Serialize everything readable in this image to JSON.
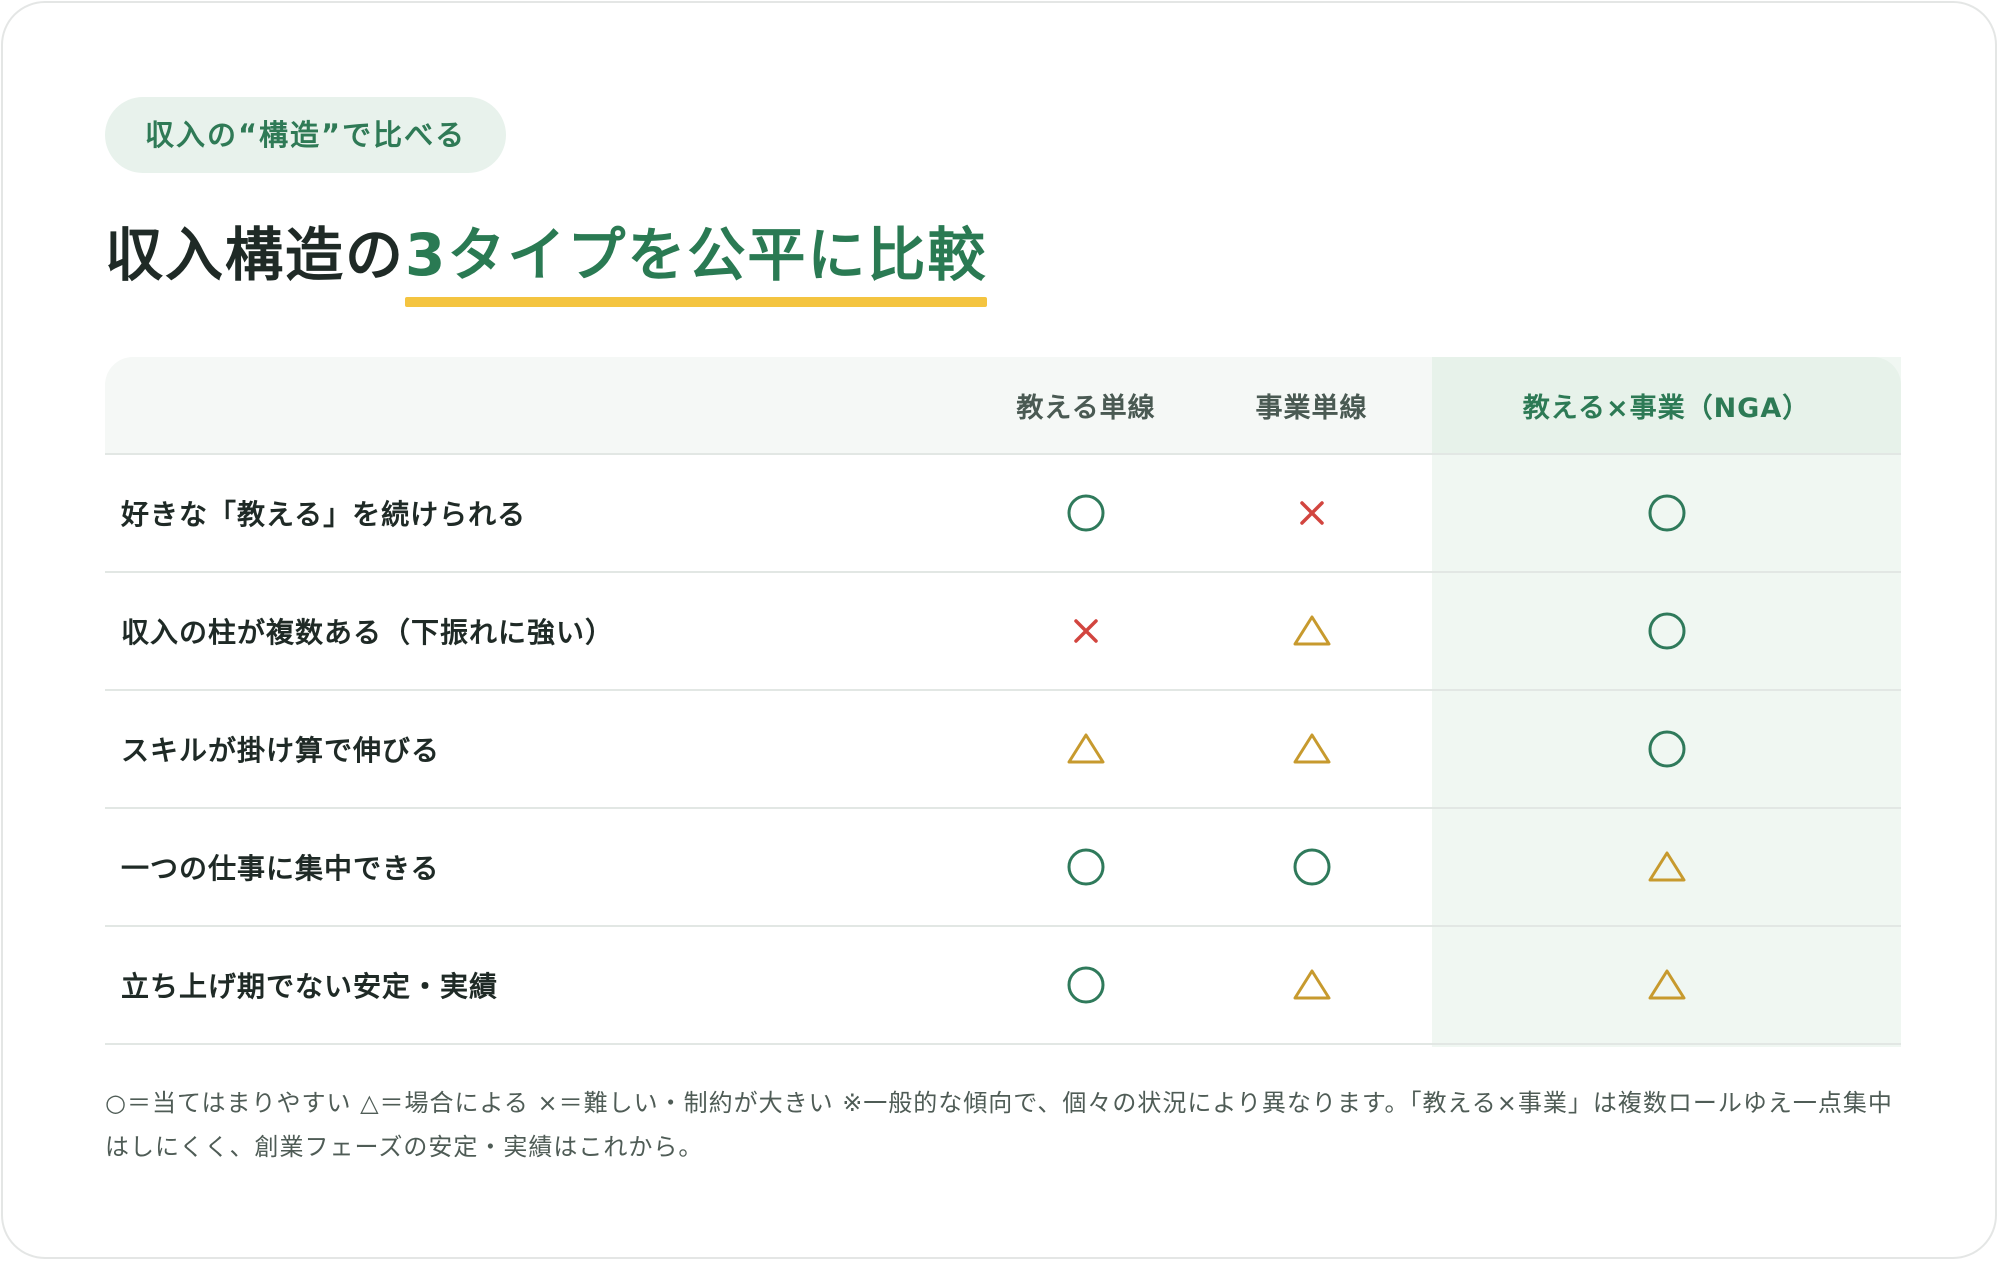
{
  "badge": "収入の“構造”で比べる",
  "title": {
    "prefix": "収入構造の",
    "highlight": "3タイプを公平に比較"
  },
  "table": {
    "columns": [
      "",
      "教える単線",
      "事業単線",
      "教える×事業（NGA）"
    ],
    "rows": [
      {
        "label": "好きな「教える」を続けられる",
        "marks": [
          "circle",
          "cross",
          "circle"
        ]
      },
      {
        "label": "収入の柱が複数ある（下振れに強い）",
        "marks": [
          "cross",
          "triangle",
          "circle"
        ]
      },
      {
        "label": "スキルが掛け算で伸びる",
        "marks": [
          "triangle",
          "triangle",
          "circle"
        ]
      },
      {
        "label": "一つの仕事に集中できる",
        "marks": [
          "circle",
          "circle",
          "triangle"
        ]
      },
      {
        "label": "立ち上げ期でない安定・実績",
        "marks": [
          "circle",
          "triangle",
          "triangle"
        ]
      }
    ]
  },
  "note": "○＝当てはまりやすい △＝場合による ×＝難しい・制約が大きい ※一般的な傾向で、個々の状況により異なります。「教える×事業」は複数ロールゆえ一点集中はしにくく、創業フェーズの安定・実績はこれから。",
  "colors": {
    "accent": "#2a7a53",
    "underline": "#f4c440",
    "circle": "#2f7a5b",
    "cross": "#d2453f",
    "triangle": "#c79a2e"
  }
}
